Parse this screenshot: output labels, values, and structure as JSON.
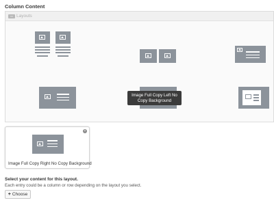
{
  "section_title": "Column Content",
  "picker": {
    "header_label": "Layouts",
    "tooltip": "Image Full Copy Left No Copy Background"
  },
  "selected": {
    "label": "Image Full Copy Right No Copy Background"
  },
  "help": {
    "title": "Select your content for this layout.",
    "text": "Each entry could be a column or row depending on the layout you select."
  },
  "choose_button": {
    "icon": "plus-icon",
    "label": "Choose"
  },
  "colors": {
    "thumbnail": "#8c939b",
    "tooltip_bg": "#3b3b3b"
  }
}
